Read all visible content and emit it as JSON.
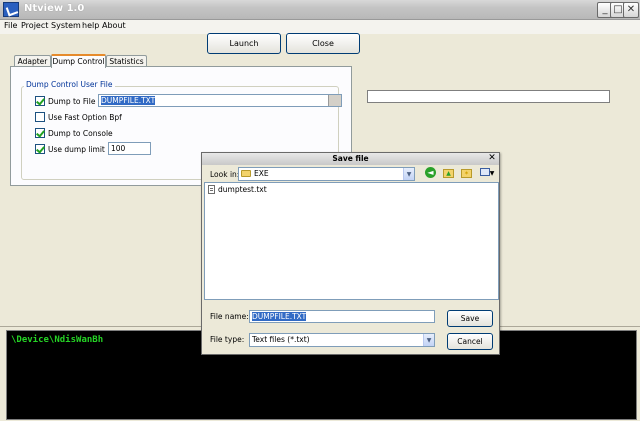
{
  "window": {
    "title": "Ntview 1.0",
    "controls": [
      "minimize",
      "maximize",
      "close"
    ]
  },
  "menu": [
    "File",
    "Project",
    "System",
    "help",
    "About"
  ],
  "toolbar": {
    "launch_label": "Launch",
    "close_label": "Close"
  },
  "tabs": [
    {
      "label": "Adapter",
      "active": false
    },
    {
      "label": "Dump Control",
      "active": true
    },
    {
      "label": "Statistics",
      "active": false
    }
  ],
  "dump_group": {
    "title": "Dump Control User File",
    "dump_to_file": {
      "label": "Dump to File",
      "checked": true,
      "value": "DUMPFILE.TXT"
    },
    "fast_option": {
      "label": "Use Fast Option Bpf",
      "checked": false
    },
    "dump_console": {
      "label": "Dump to Console",
      "checked": true
    },
    "dump_limit": {
      "label": "Use dump limit",
      "checked": true,
      "value": "100"
    }
  },
  "console": {
    "text": "\\Device\\NdisWanBh"
  },
  "save_dialog": {
    "title": "Save file",
    "look_in_label": "Look in:",
    "look_in_value": "EXE",
    "files": [
      "dumptest.txt"
    ],
    "file_name_label": "File name:",
    "file_name_value": "DUMPFILE.TXT",
    "file_type_label": "File type:",
    "file_type_value": "Text files (*.txt)",
    "save_label": "Save",
    "cancel_label": "Cancel"
  },
  "colors": {
    "console_bg": "#000000",
    "console_text": "#25d325",
    "selection": "#316ac5",
    "tab_accent": "#e68b2c"
  }
}
